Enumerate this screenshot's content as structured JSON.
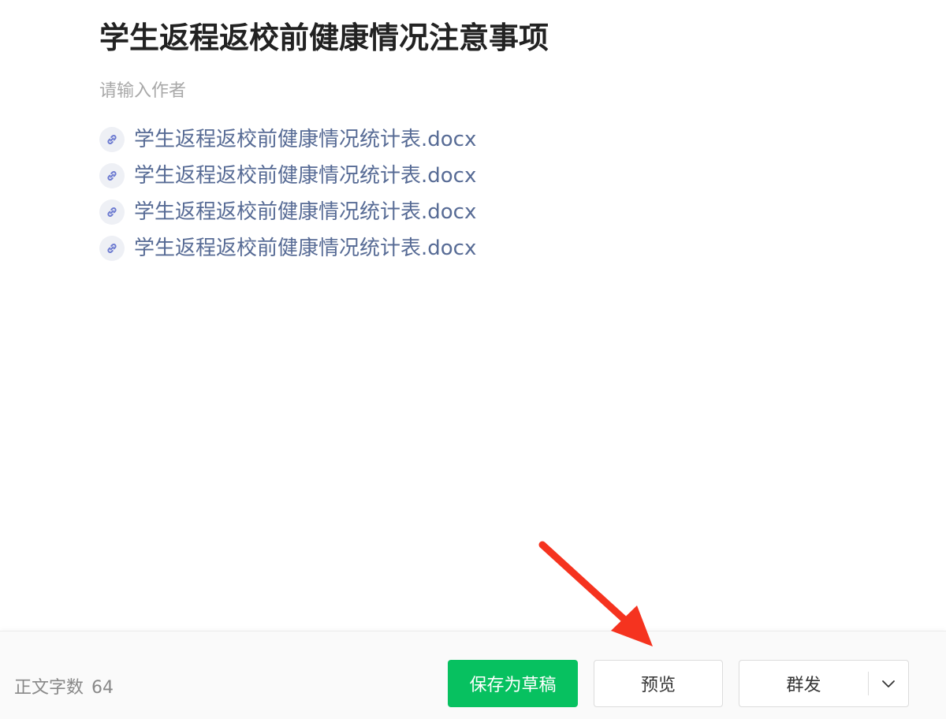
{
  "article": {
    "title": "学生返程返校前健康情况注意事项",
    "author_placeholder": "请输入作者",
    "author_value": ""
  },
  "attachments": [
    {
      "name": "学生返程返校前健康情况统计表.docx",
      "icon": "link-icon"
    },
    {
      "name": "学生返程返校前健康情况统计表.docx",
      "icon": "link-icon"
    },
    {
      "name": "学生返程返校前健康情况统计表.docx",
      "icon": "link-icon"
    },
    {
      "name": "学生返程返校前健康情况统计表.docx",
      "icon": "link-icon"
    }
  ],
  "footer": {
    "word_count_label": "正文字数",
    "word_count_value": "64",
    "save_draft_label": "保存为草稿",
    "preview_label": "预览",
    "send_label": "群发",
    "dropdown_icon": "chevron-down-icon"
  },
  "annotation": {
    "arrow_color": "#f5331f",
    "arrow_target": "preview-button"
  },
  "colors": {
    "accent_green": "#07c160",
    "link_blue": "#576b95",
    "placeholder_gray": "#a8a8a8"
  }
}
